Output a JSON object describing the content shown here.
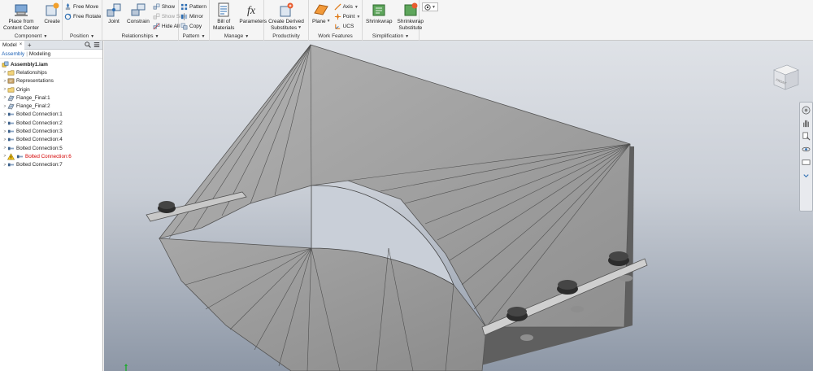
{
  "ribbon": {
    "panels": {
      "component": {
        "title": "Component",
        "place_from_content_center": [
          "Place from",
          "Content Center"
        ],
        "create": "Create"
      },
      "position": {
        "title": "Position",
        "free_move": "Free Move",
        "free_rotate": "Free Rotate"
      },
      "relationships": {
        "title": "Relationships",
        "joint": "Joint",
        "constrain": "Constrain",
        "show": "Show",
        "show_sick": "Show Sick",
        "hide_all": "Hide All"
      },
      "pattern": {
        "title": "Pattern",
        "pattern": "Pattern",
        "mirror": "Mirror",
        "copy": "Copy"
      },
      "manage": {
        "title": "Manage",
        "bill_of_materials": [
          "Bill of",
          "Materials"
        ],
        "parameters": "Parameters"
      },
      "productivity": {
        "title": "Productivity",
        "create_derived_substitutes": [
          "Create Derived",
          "Substitutes"
        ]
      },
      "work_features": {
        "title": "Work Features",
        "plane": "Plane",
        "axis": "Axis",
        "point": "Point",
        "ucs": "UCS"
      },
      "simplification": {
        "title": "Simplification",
        "shrinkwrap": "Shrinkwrap",
        "shrinkwrap_substitute": [
          "Shrinkwrap",
          "Substitute"
        ]
      }
    }
  },
  "browser": {
    "tab_label": "Model",
    "close_glyph": "×",
    "plus_glyph": "+",
    "mode_assembly": "Assembly",
    "mode_separator": "|",
    "mode_modeling": "Modeling",
    "tree": [
      {
        "label": "Assembly1.iam",
        "icon": "assembly-icon",
        "root": true
      },
      {
        "label": "Relationships",
        "icon": "relationships-folder-icon"
      },
      {
        "label": "Representations",
        "icon": "representations-icon"
      },
      {
        "label": "Origin",
        "icon": "origin-folder-icon"
      },
      {
        "label": "Flange_Final:1",
        "icon": "part-icon"
      },
      {
        "label": "Flange_Final:2",
        "icon": "part-icon"
      },
      {
        "label": "Bolted Connection:1",
        "icon": "bolted-connection-icon"
      },
      {
        "label": "Bolted Connection:2",
        "icon": "bolted-connection-icon"
      },
      {
        "label": "Bolted Connection:3",
        "icon": "bolted-connection-icon"
      },
      {
        "label": "Bolted Connection:4",
        "icon": "bolted-connection-icon"
      },
      {
        "label": "Bolted Connection:5",
        "icon": "bolted-connection-icon"
      },
      {
        "label": "Bolted Connection:6",
        "icon": "warning-icon",
        "error": true
      },
      {
        "label": "Bolted Connection:7",
        "icon": "bolted-connection-icon"
      }
    ]
  },
  "viewcube": {
    "face_label": "FRONT"
  },
  "colors": {
    "accent": "#1a5fb4",
    "error": "#d40000",
    "sheet_metal": "#9c9c9c",
    "viewport_top": "#dfe2e7",
    "viewport_bottom": "#8d97a6"
  }
}
